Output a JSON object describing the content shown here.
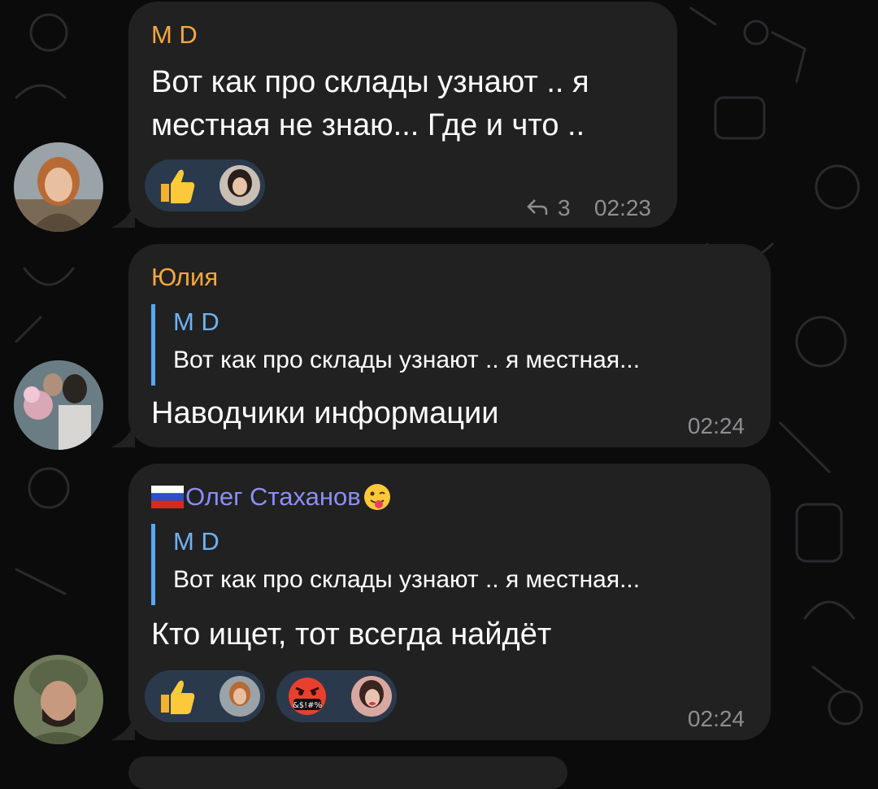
{
  "colors": {
    "background": "#0b0b0c",
    "bubble": "#212121",
    "sender_md": "#f5a742",
    "sender_yulia": "#f5a742",
    "sender_oleg": "#8d8df5",
    "reply_bar": "#5aa7ef",
    "reply_name": "#6fb2f2",
    "time": "#8e8e93",
    "reaction_bg": "#2a3a4c"
  },
  "messages": [
    {
      "sender": "M D",
      "text_line1": "Вот как про склады узнают .. я",
      "text_line2": "местная не знаю... Где и что ..",
      "reactions": [
        {
          "emoji": "thumbs-up-icon"
        }
      ],
      "replies_icon": "reply-arrow-icon",
      "replies_count": "3",
      "time": "02:23"
    },
    {
      "sender": "Юлия",
      "reply_to": {
        "name": "M D",
        "text": "Вот как про склады узнают .. я местная..."
      },
      "text": "Наводчики информации",
      "time": "02:24"
    },
    {
      "sender_flag": "russia-flag-icon",
      "sender": "Олег Стаханов",
      "sender_emoji": "winking-tongue-emoji-icon",
      "reply_to": {
        "name": "M D",
        "text": "Вот как про склады узнают .. я местная..."
      },
      "text": "Кто ищет, тот всегда найдёт",
      "reactions": [
        {
          "emoji": "thumbs-up-icon"
        },
        {
          "emoji": "swearing-face-icon",
          "label": "&$!#%"
        }
      ],
      "time": "02:24"
    }
  ]
}
